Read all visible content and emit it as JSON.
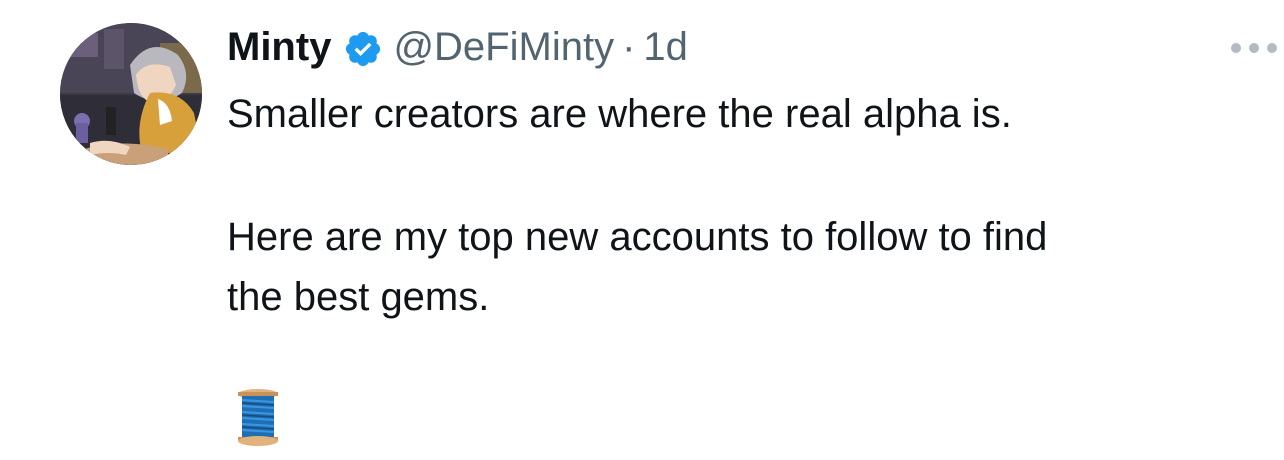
{
  "tweet": {
    "author": {
      "display_name": "Minty",
      "handle": "@DeFiMinty",
      "verified": true,
      "avatar_icon": "anime-avatar-icon"
    },
    "separator": "·",
    "time": "1d",
    "text": {
      "line1": "Smaller creators are where the real alpha is.",
      "para2_line1": "Here are my top new accounts to follow to find",
      "para2_line2": "the best gems."
    },
    "emoji": "thread-spool-icon",
    "more_icon": "more-options-icon"
  },
  "colors": {
    "text": "#0f1419",
    "secondary": "#536471",
    "verified_blue": "#1d9bf0",
    "more_dots": "#b3bac1"
  }
}
